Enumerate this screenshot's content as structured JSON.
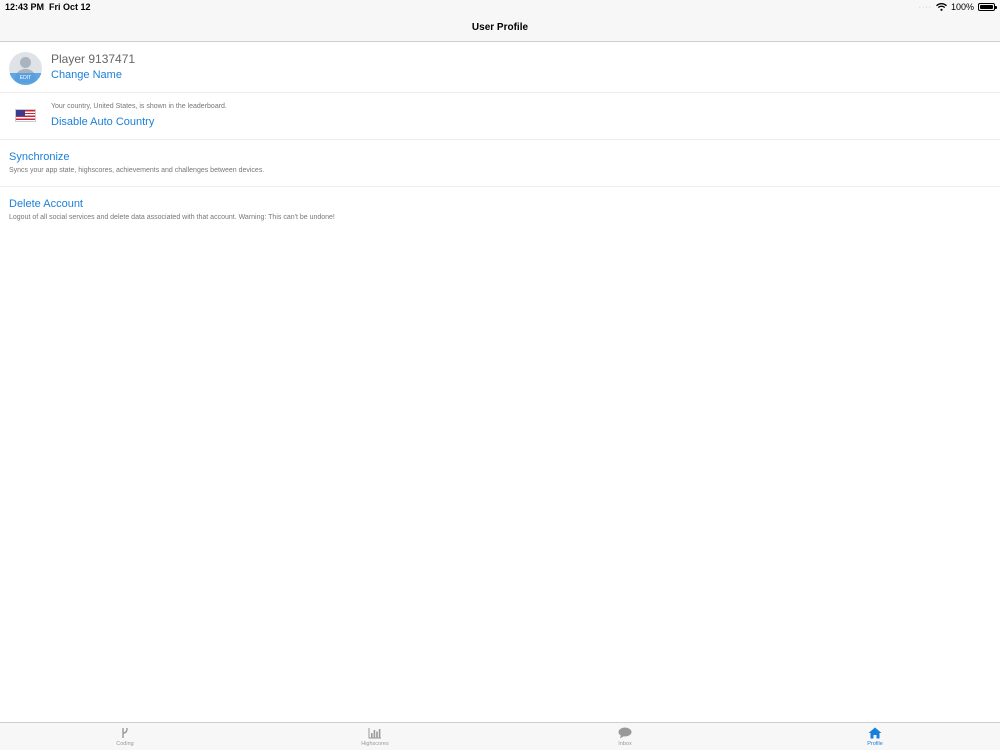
{
  "status_bar": {
    "time": "12:43 PM",
    "date": "Fri Oct 12",
    "dots": "····",
    "battery": "100%",
    "battery_level": 1.0
  },
  "nav": {
    "title": "User Profile"
  },
  "profile": {
    "player_name": "Player 9137471",
    "avatar_edit_label": "EDIT",
    "change_name_label": "Change Name"
  },
  "country": {
    "description": "Your country, United States, is shown in the leaderboard.",
    "toggle_label": "Disable Auto Country",
    "flag_icon": "us-flag-icon"
  },
  "sync": {
    "title": "Synchronize",
    "description": "Syncs your app state, highscores, achievements and challenges between devices."
  },
  "delete": {
    "title": "Delete Account",
    "description": "Logout of all social services and delete data associated with that account. Warning: This can't be undone!"
  },
  "tabs": [
    {
      "label": "Coding",
      "icon": "branch-icon",
      "active": false
    },
    {
      "label": "Highscores",
      "icon": "bar-chart-icon",
      "active": false
    },
    {
      "label": "Inbox",
      "icon": "chat-bubble-icon",
      "active": false
    },
    {
      "label": "Profile",
      "icon": "home-icon",
      "active": true
    }
  ],
  "colors": {
    "accent": "#1a7fd8",
    "inactive": "#999999",
    "bar_bg": "#f7f7f7"
  }
}
